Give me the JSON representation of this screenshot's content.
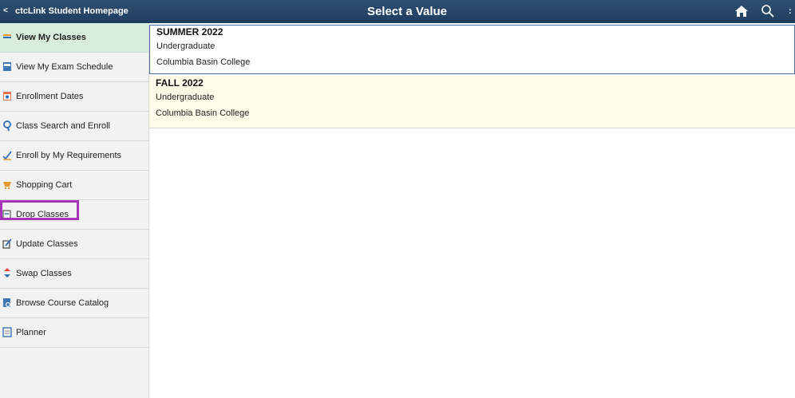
{
  "header": {
    "back_glyph": "<",
    "home_title": "ctcLink Student Homepage",
    "page_title": "Select a Value",
    "more_glyph": ":",
    "icons": [
      "home-icon",
      "search-icon"
    ]
  },
  "sidebar": {
    "items": [
      {
        "label": "View My Classes",
        "icon": "classes-icon",
        "selected": true
      },
      {
        "label": "View My Exam Schedule",
        "icon": "exam-icon",
        "selected": false
      },
      {
        "label": "Enrollment Dates",
        "icon": "calendar-icon",
        "selected": false
      },
      {
        "label": "Class Search and Enroll",
        "icon": "search-icon",
        "selected": false
      },
      {
        "label": "Enroll by My Requirements",
        "icon": "check-icon",
        "selected": false
      },
      {
        "label": "Shopping Cart",
        "icon": "cart-icon",
        "selected": false
      },
      {
        "label": "Drop Classes",
        "icon": "drop-icon",
        "selected": false
      },
      {
        "label": "Update Classes",
        "icon": "edit-icon",
        "selected": false
      },
      {
        "label": "Swap Classes",
        "icon": "swap-icon",
        "selected": false
      },
      {
        "label": "Browse Course Catalog",
        "icon": "catalog-icon",
        "selected": false
      },
      {
        "label": "Planner",
        "icon": "planner-icon",
        "selected": false
      }
    ]
  },
  "terms": [
    {
      "name": "SUMMER 2022",
      "career": "Undergraduate",
      "institution": "Columbia Basin College"
    },
    {
      "name": "FALL 2022",
      "career": "Undergraduate",
      "institution": "Columbia Basin College"
    }
  ],
  "colors": {
    "header": "#1f3d5e",
    "selected": "#d8eddc",
    "highlight": "#a733b8",
    "term_bg": "#fffde9"
  }
}
